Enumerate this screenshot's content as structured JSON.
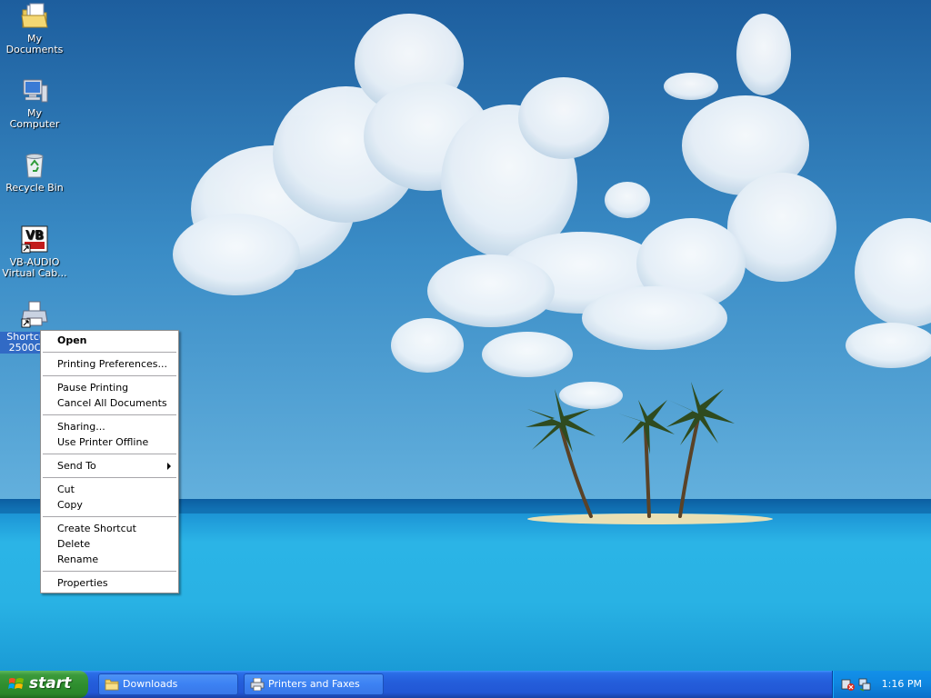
{
  "desktop": {
    "icons": [
      {
        "name": "My Documents",
        "icon": "folder-documents-icon"
      },
      {
        "name": "My Computer",
        "icon": "computer-icon"
      },
      {
        "name": "Recycle Bin",
        "icon": "recycle-bin-icon"
      },
      {
        "name": "VB-AUDIO Virtual Cab...",
        "icon": "vb-audio-icon"
      },
      {
        "name": "Shortcut to 2500C S...",
        "icon": "printer-shortcut-icon",
        "selected": true
      }
    ]
  },
  "context_menu": {
    "items": [
      {
        "label": "Open",
        "bold": true
      },
      {
        "label": "Printing Preferences..."
      },
      {
        "label": "Pause Printing"
      },
      {
        "label": "Cancel All Documents"
      },
      {
        "label": "Sharing..."
      },
      {
        "label": "Use Printer Offline"
      },
      {
        "label": "Send To",
        "submenu": true
      },
      {
        "label": "Cut"
      },
      {
        "label": "Copy"
      },
      {
        "label": "Create Shortcut"
      },
      {
        "label": "Delete"
      },
      {
        "label": "Rename"
      },
      {
        "label": "Properties"
      }
    ]
  },
  "taskbar": {
    "start_label": "start",
    "buttons": [
      {
        "label": "Downloads",
        "icon": "folder-icon"
      },
      {
        "label": "Printers and Faxes",
        "icon": "printers-faxes-icon"
      }
    ],
    "tray_icons": [
      "volume-icon",
      "network-icon"
    ],
    "clock": "1:16 PM"
  },
  "colors": {
    "taskbar_blue": "#245edb",
    "start_green": "#3c9a3c",
    "tray_blue": "#0f86e0",
    "selection_blue": "#316ac5"
  }
}
